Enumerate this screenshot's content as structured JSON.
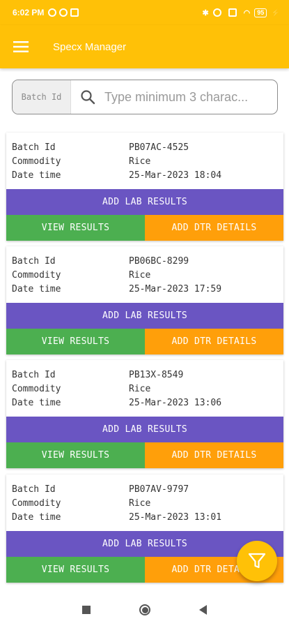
{
  "status_bar": {
    "time": "6:02 PM",
    "battery": "95"
  },
  "app_bar": {
    "title": "Specx Manager"
  },
  "search": {
    "prefix_label": "Batch Id",
    "placeholder": "Type minimum 3 charac..."
  },
  "field_labels": {
    "batch_id": "Batch Id",
    "commodity": "Commodity",
    "date_time": "Date time"
  },
  "buttons": {
    "add_lab_results": "ADD LAB RESULTS",
    "view_results": "VIEW RESULTS",
    "add_dtr_details": "ADD DTR DETAILS"
  },
  "batches": [
    {
      "batch_id": "PB07AC-4525",
      "commodity": "Rice",
      "date_time": "25-Mar-2023 18:04"
    },
    {
      "batch_id": "PB06BC-8299",
      "commodity": "Rice",
      "date_time": "25-Mar-2023 17:59"
    },
    {
      "batch_id": "PB13X-8549",
      "commodity": "Rice",
      "date_time": "25-Mar-2023 13:06"
    },
    {
      "batch_id": "PB07AV-9797",
      "commodity": "Rice",
      "date_time": "25-Mar-2023 13:01"
    }
  ],
  "colors": {
    "primary": "#ffc107",
    "lab_button": "#6a55c2",
    "view_button": "#4caf50",
    "dtr_button": "#ff9f0a"
  },
  "icons": {
    "menu": "hamburger-menu-icon",
    "search": "search-icon",
    "filter": "filter-icon"
  }
}
